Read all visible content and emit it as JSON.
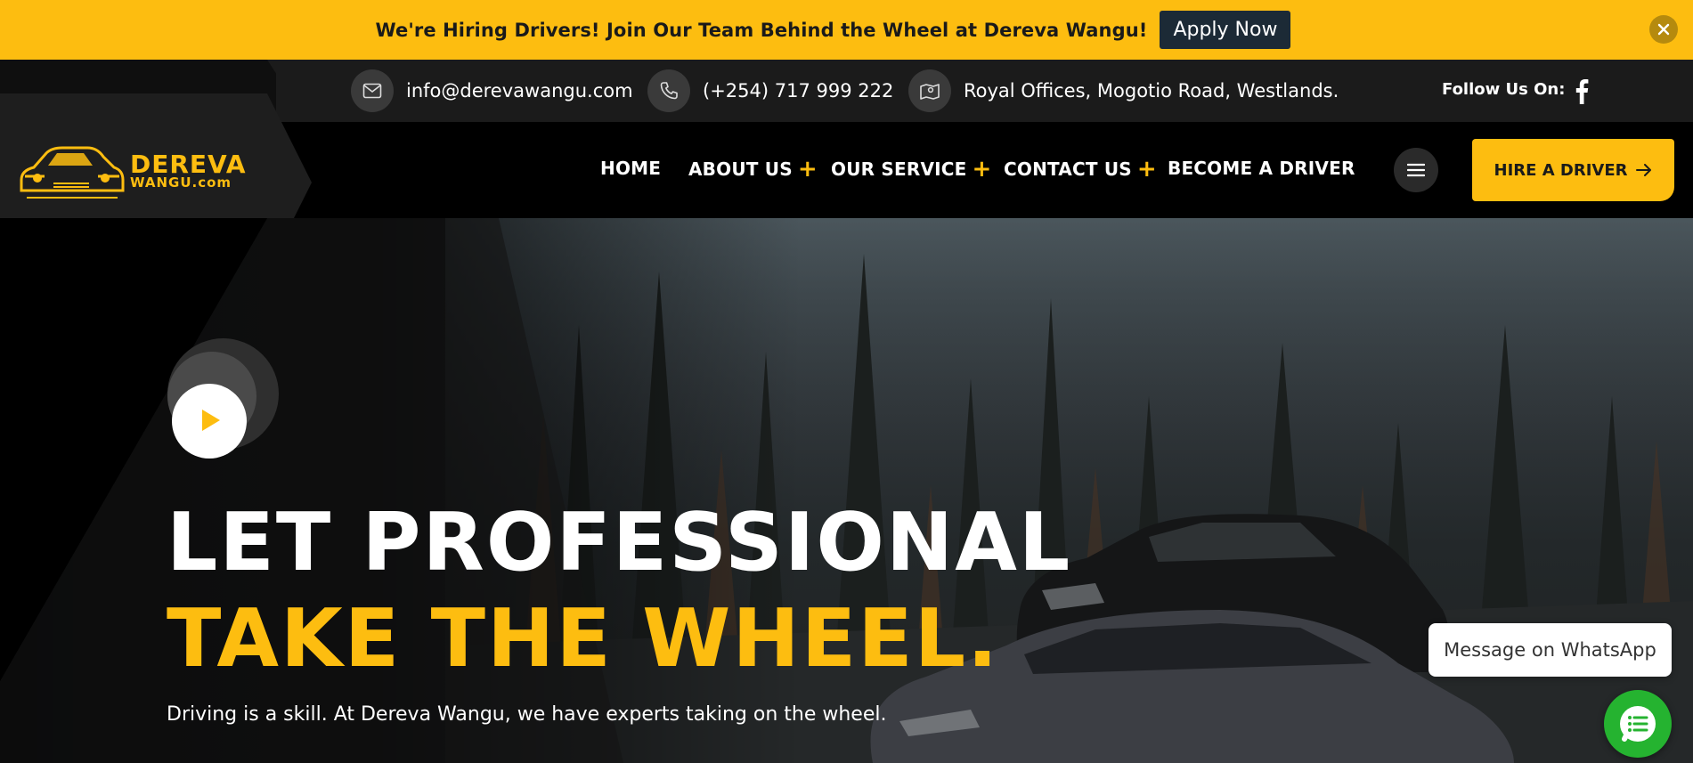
{
  "announcement": {
    "text": "We're Hiring Drivers! Join Our Team Behind the Wheel at Dereva Wangu!",
    "button_label": "Apply Now",
    "close_icon": "close-icon"
  },
  "topbar": {
    "email": "info@derevawangu.com",
    "phone": "(+254) 717 999 222",
    "address": "Royal Offices, Mogotio Road, Westlands.",
    "follow_label": "Follow Us On:"
  },
  "logo": {
    "line1": "DEREVA",
    "line2": "WANGU.com"
  },
  "nav": {
    "items": [
      {
        "label": "HOME"
      },
      {
        "label": "ABOUT US"
      },
      {
        "label": "OUR SERVICE"
      },
      {
        "label": "CONTACT US"
      },
      {
        "label": "BECOME A DRIVER"
      }
    ],
    "plus": "+",
    "hire_label": "HIRE A DRIVER"
  },
  "hero": {
    "headline_line1": "LET PROFESSIONAL",
    "headline_line2": "TAKE THE WHEEL.",
    "subtitle": "Driving is a skill. At Dereva Wangu, we have experts taking on the wheel."
  },
  "whatsapp": {
    "message_label": "Message on WhatsApp"
  },
  "colors": {
    "accent": "#fdbd10",
    "announce_button": "#1c2a36",
    "whatsapp": "#25b330"
  }
}
